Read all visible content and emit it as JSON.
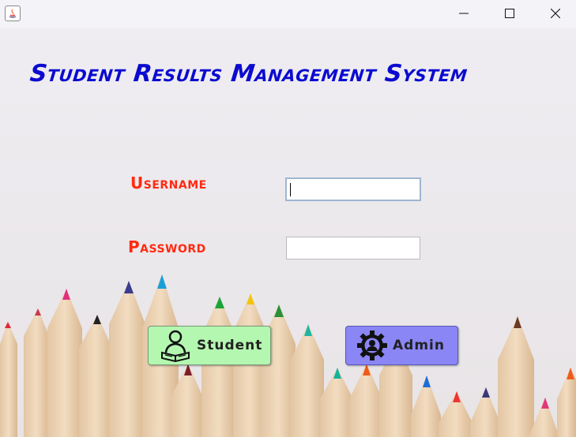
{
  "window": {
    "controls": {
      "minimize_icon": "minimize-icon",
      "maximize_icon": "maximize-icon",
      "close_icon": "close-icon"
    }
  },
  "main": {
    "title": "Student Results Management System",
    "username_label": "Username",
    "password_label": "Password",
    "username_value": "",
    "password_value": ""
  },
  "buttons": {
    "student_label": "Student",
    "student_icon": "reading-student-icon",
    "admin_label": "Admin",
    "admin_icon": "gear-user-icon"
  },
  "colors": {
    "title": "#0b0bd0",
    "labels": "#ff2a10",
    "student_button": "#b4f7b0",
    "admin_button": "#8a86f5"
  }
}
